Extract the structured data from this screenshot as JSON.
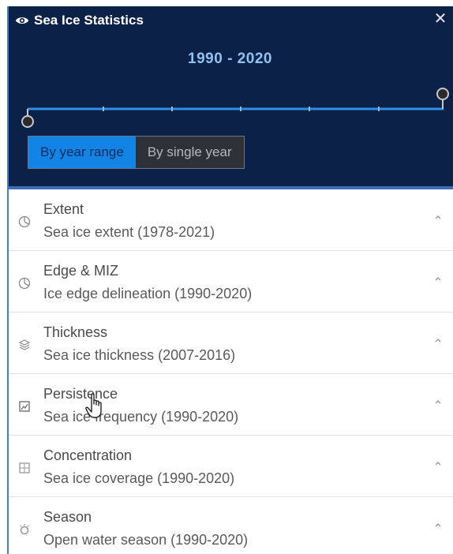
{
  "panel": {
    "title": "Sea Ice Statistics",
    "title_icon": "eye-icon",
    "close_icon": "close-icon",
    "close_glyph": "✕",
    "colors": {
      "header_bg": "#0b2148",
      "range_text": "#8ec4f2",
      "active_toggle": "#1284e6",
      "inactive_toggle": "#2f3138",
      "slider_track": "#2f8fe0"
    }
  },
  "range": {
    "label": "1990 - 2020",
    "start_year": 1990,
    "end_year": 2020
  },
  "toggle": {
    "year_range_label": "By year range",
    "single_year_label": "By single year",
    "selected": "By year range"
  },
  "items": [
    {
      "title": "Extent",
      "subtitle": "Sea ice extent (1978-2021)",
      "icon": "pie-chart-icon"
    },
    {
      "title": "Edge & MIZ",
      "subtitle": "Ice edge delineation (1990-2020)",
      "icon": "pie-chart-icon"
    },
    {
      "title": "Thickness",
      "subtitle": "Sea ice thickness (2007-2016)",
      "icon": "layers-icon"
    },
    {
      "title": "Persistence",
      "subtitle": "Sea ice frequency (1990-2020)",
      "icon": "grid-chart-icon"
    },
    {
      "title": "Concentration",
      "subtitle": "Sea ice coverage (1990-2020)",
      "icon": "grid-chart-icon"
    },
    {
      "title": "Season",
      "subtitle": "Open water season (1990-2020)",
      "icon": "bulb-icon"
    }
  ]
}
